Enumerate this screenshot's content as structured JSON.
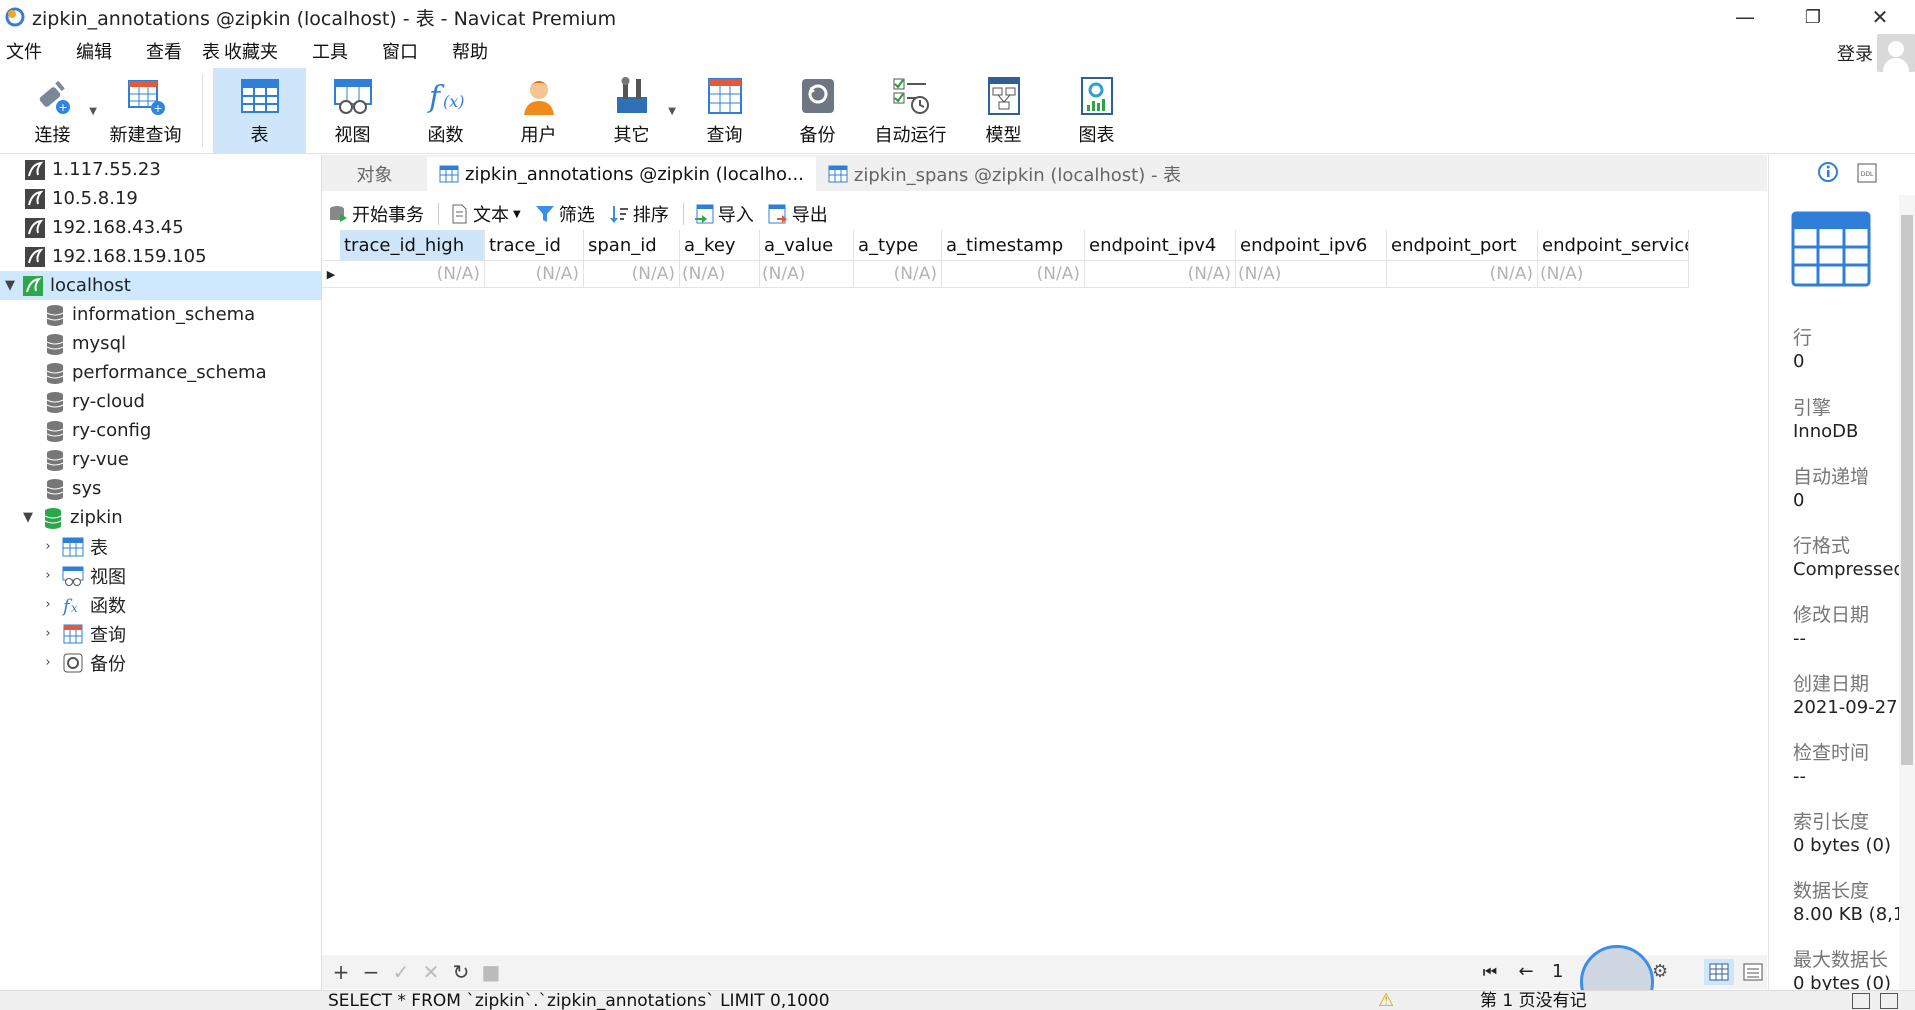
{
  "window": {
    "title": "zipkin_annotations @zipkin (localhost) - 表 - Navicat Premium",
    "minimize": "—",
    "maximize": "❐",
    "close": "✕"
  },
  "menu": {
    "items": [
      "文件",
      "编辑",
      "查看",
      "表",
      "收藏夹",
      "工具",
      "窗口",
      "帮助"
    ],
    "login": "登录"
  },
  "toolbar": {
    "items": [
      {
        "label": "连接",
        "icon": "plug-icon"
      },
      {
        "label": "新建查询",
        "icon": "new-query-icon"
      },
      {
        "label": "表",
        "icon": "table-icon"
      },
      {
        "label": "视图",
        "icon": "view-icon"
      },
      {
        "label": "函数",
        "icon": "function-icon"
      },
      {
        "label": "用户",
        "icon": "user-icon"
      },
      {
        "label": "其它",
        "icon": "tools-icon"
      },
      {
        "label": "查询",
        "icon": "query-icon"
      },
      {
        "label": "备份",
        "icon": "backup-icon"
      },
      {
        "label": "自动运行",
        "icon": "schedule-icon"
      },
      {
        "label": "模型",
        "icon": "model-icon"
      },
      {
        "label": "图表",
        "icon": "chart-icon"
      }
    ]
  },
  "tree": {
    "connections": [
      "1.117.55.23",
      "10.5.8.19",
      "192.168.43.45",
      "192.168.159.105"
    ],
    "active_connection": "localhost",
    "databases": [
      "information_schema",
      "mysql",
      "performance_schema",
      "ry-cloud",
      "ry-config",
      "ry-vue",
      "sys"
    ],
    "open_database": "zipkin",
    "children": [
      "表",
      "视图",
      "函数",
      "查询",
      "备份"
    ]
  },
  "tabs": {
    "objects": "对象",
    "active": "zipkin_annotations @zipkin (localho...",
    "other": "zipkin_spans @zipkin (localhost) - 表"
  },
  "subtoolbar": {
    "begin_transaction": "开始事务",
    "text": "文本",
    "filter": "筛选",
    "sort": "排序",
    "import": "导入",
    "export": "导出"
  },
  "grid": {
    "columns": [
      "trace_id_high",
      "trace_id",
      "span_id",
      "a_key",
      "a_value",
      "a_type",
      "a_timestamp",
      "endpoint_ipv4",
      "endpoint_ipv6",
      "endpoint_port",
      "endpoint_service"
    ],
    "rows": [
      [
        "(N/A)",
        "(N/A)",
        "(N/A)",
        "(N/A)",
        "(N/A)",
        "(N/A)",
        "(N/A)",
        "(N/A)",
        "(N/A)",
        "(N/A)",
        "(N/A)"
      ]
    ]
  },
  "bottom": {
    "add": "+",
    "remove": "−",
    "apply": "✓",
    "discard": "✕",
    "refresh": "↻",
    "stop": "■",
    "page": "1"
  },
  "status": {
    "sql": "SELECT * FROM `zipkin`.`zipkin_annotations` LIMIT 0,1000",
    "page_info": "第 1 页没有记"
  },
  "info_panel": {
    "rows_label": "行",
    "rows_value": "0",
    "engine_label": "引擎",
    "engine_value": "InnoDB",
    "auto_inc_label": "自动递增",
    "auto_inc_value": "0",
    "row_format_label": "行格式",
    "row_format_value": "Compressed",
    "modified_label": "修改日期",
    "modified_value": "--",
    "created_label": "创建日期",
    "created_value": "2021-09-27",
    "check_time_label": "检查时间",
    "check_time_value": "--",
    "index_length_label": "索引长度",
    "index_length_value": "0 bytes (0)",
    "data_length_label": "数据长度",
    "data_length_value": "8.00 KB (8,1",
    "max_data_label": "最大数据长",
    "max_data_value": "0 bytes (0)"
  }
}
